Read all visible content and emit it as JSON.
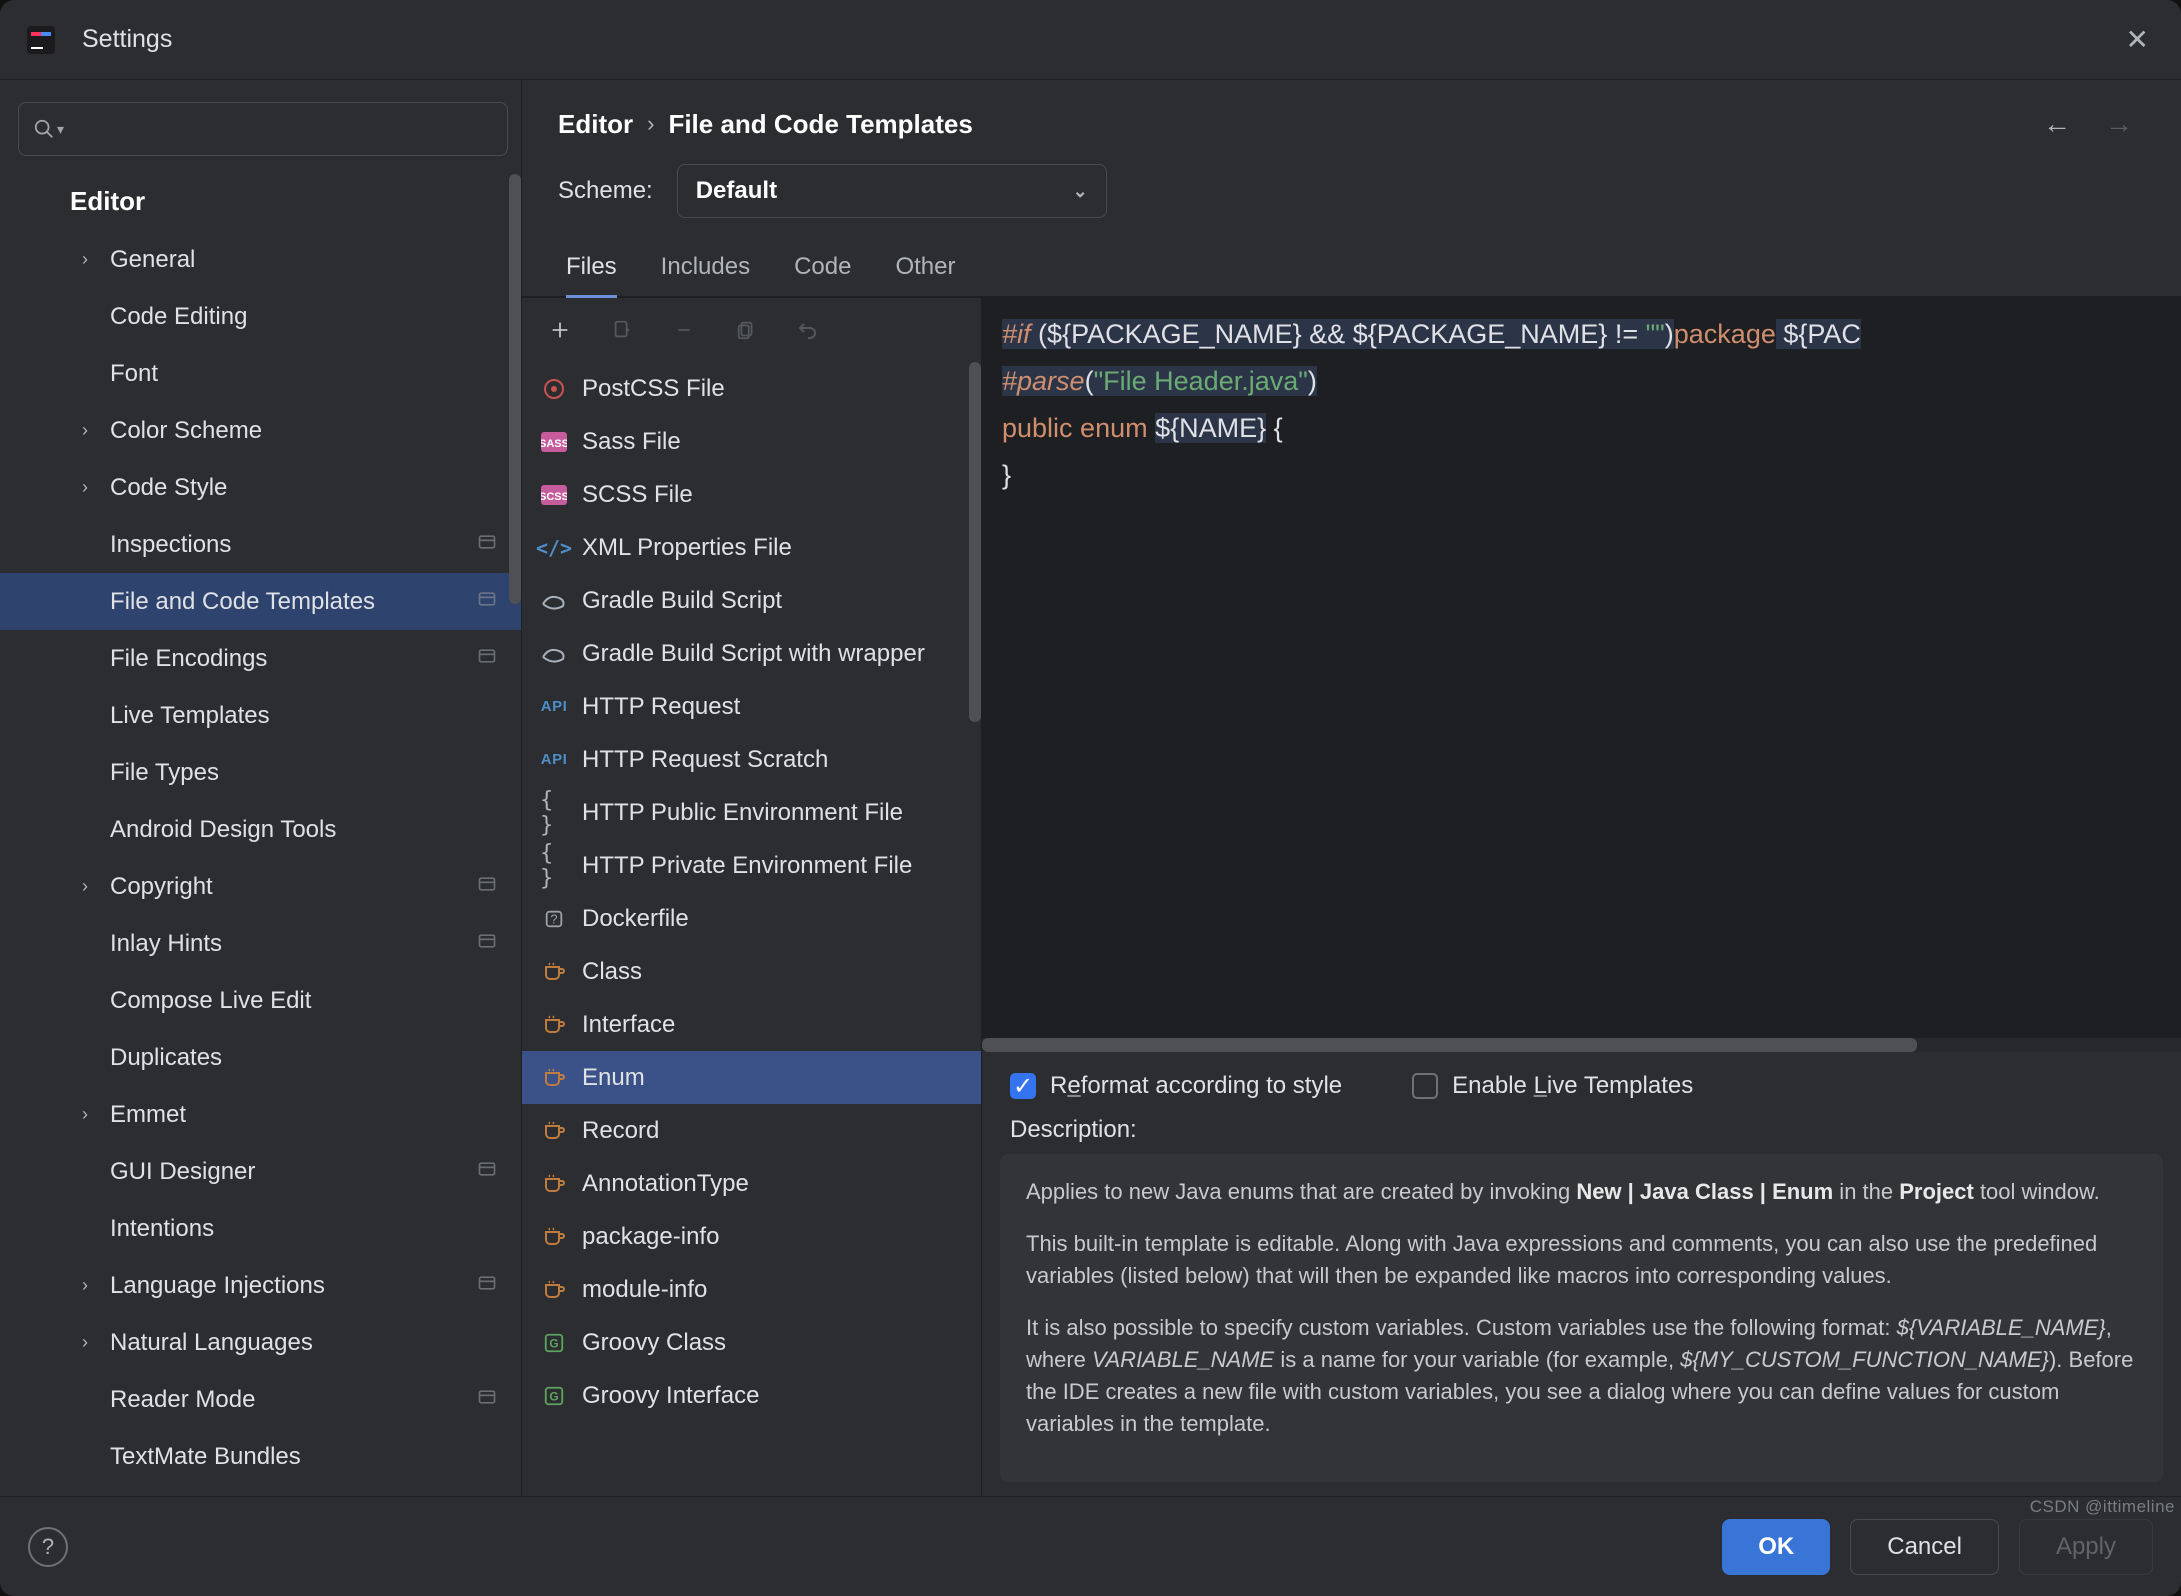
{
  "window": {
    "title": "Settings"
  },
  "breadcrumb": {
    "root": "Editor",
    "leaf": "File and Code Templates"
  },
  "scheme": {
    "label": "Scheme:",
    "value": "Default"
  },
  "tabs": [
    "Files",
    "Includes",
    "Code",
    "Other"
  ],
  "active_tab": 0,
  "sidebar": {
    "heading": "Editor",
    "items": [
      {
        "label": "General",
        "expandable": true
      },
      {
        "label": "Code Editing"
      },
      {
        "label": "Font"
      },
      {
        "label": "Color Scheme",
        "expandable": true
      },
      {
        "label": "Code Style",
        "expandable": true
      },
      {
        "label": "Inspections",
        "scope": true
      },
      {
        "label": "File and Code Templates",
        "selected": true,
        "scope": true
      },
      {
        "label": "File Encodings",
        "scope": true
      },
      {
        "label": "Live Templates"
      },
      {
        "label": "File Types"
      },
      {
        "label": "Android Design Tools"
      },
      {
        "label": "Copyright",
        "expandable": true,
        "scope": true
      },
      {
        "label": "Inlay Hints",
        "scope": true
      },
      {
        "label": "Compose Live Edit"
      },
      {
        "label": "Duplicates"
      },
      {
        "label": "Emmet",
        "expandable": true
      },
      {
        "label": "GUI Designer",
        "scope": true
      },
      {
        "label": "Intentions"
      },
      {
        "label": "Language Injections",
        "expandable": true,
        "scope": true
      },
      {
        "label": "Natural Languages",
        "expandable": true
      },
      {
        "label": "Reader Mode",
        "scope": true
      },
      {
        "label": "TextMate Bundles"
      }
    ]
  },
  "templates": [
    {
      "label": "PostCSS File",
      "icon": "postcss"
    },
    {
      "label": "Sass File",
      "icon": "sass"
    },
    {
      "label": "SCSS File",
      "icon": "scss"
    },
    {
      "label": "XML Properties File",
      "icon": "xml"
    },
    {
      "label": "Gradle Build Script",
      "icon": "gradle"
    },
    {
      "label": "Gradle Build Script with wrapper",
      "icon": "gradle"
    },
    {
      "label": "HTTP Request",
      "icon": "api"
    },
    {
      "label": "HTTP Request Scratch",
      "icon": "api"
    },
    {
      "label": "HTTP Public Environment File",
      "icon": "braces"
    },
    {
      "label": "HTTP Private Environment File",
      "icon": "braces"
    },
    {
      "label": "Dockerfile",
      "icon": "docker"
    },
    {
      "label": "Class",
      "icon": "cup"
    },
    {
      "label": "Interface",
      "icon": "cup"
    },
    {
      "label": "Enum",
      "icon": "cup",
      "selected": true
    },
    {
      "label": "Record",
      "icon": "cup"
    },
    {
      "label": "AnnotationType",
      "icon": "cup"
    },
    {
      "label": "package-info",
      "icon": "cup"
    },
    {
      "label": "module-info",
      "icon": "cup"
    },
    {
      "label": "Groovy Class",
      "icon": "groovy"
    },
    {
      "label": "Groovy Interface",
      "icon": "groovy"
    }
  ],
  "code": {
    "t_if": "#if",
    "t_lp": " (",
    "t_pkg1": "${PACKAGE_NAME}",
    "t_and": " && ",
    "t_pkg2": "${PACKAGE_NAME}",
    "t_neq": " != ",
    "t_empty": "\"\"",
    "t_rp": ")",
    "t_package": "package",
    "t_pkg3": " ${PAC",
    "t_parse": "#parse",
    "t_parse_lp": "(",
    "t_header": "\"File Header.java\"",
    "t_parse_rp": ")",
    "t_public": "public",
    "t_enum": " enum ",
    "t_name": "${NAME}",
    "t_ob": " {",
    "t_cb": "}"
  },
  "checks": {
    "reformat": {
      "label_pre": "R",
      "label_ul": "e",
      "label_post": "format according to style",
      "checked": true
    },
    "livetpl": {
      "label_pre": "Enable ",
      "label_ul": "L",
      "label_post": "ive Templates",
      "checked": false
    }
  },
  "description": {
    "heading": "Description:",
    "p1a": "Applies to new Java enums that are created by invoking ",
    "p1b": "New | Java Class | Enum",
    "p1c": " in the ",
    "p1d": "Project",
    "p1e": " tool window.",
    "p2": "This built-in template is editable. Along with Java expressions and comments, you can also use the predefined variables (listed below) that will then be expanded like macros into corresponding values.",
    "p3a": "It is also possible to specify custom variables. Custom variables use the following format: ",
    "p3b": "${VARIABLE_NAME}",
    "p3c": ", where ",
    "p3d": "VARIABLE_NAME",
    "p3e": " is a name for your variable (for example, ",
    "p3f": "${MY_CUSTOM_FUNCTION_NAME}",
    "p3g": "). Before the IDE creates a new file with custom variables, you see a dialog where you can define values for custom variables in the template."
  },
  "footer": {
    "ok": "OK",
    "cancel": "Cancel",
    "apply": "Apply"
  },
  "watermark": "CSDN @ittimeline"
}
